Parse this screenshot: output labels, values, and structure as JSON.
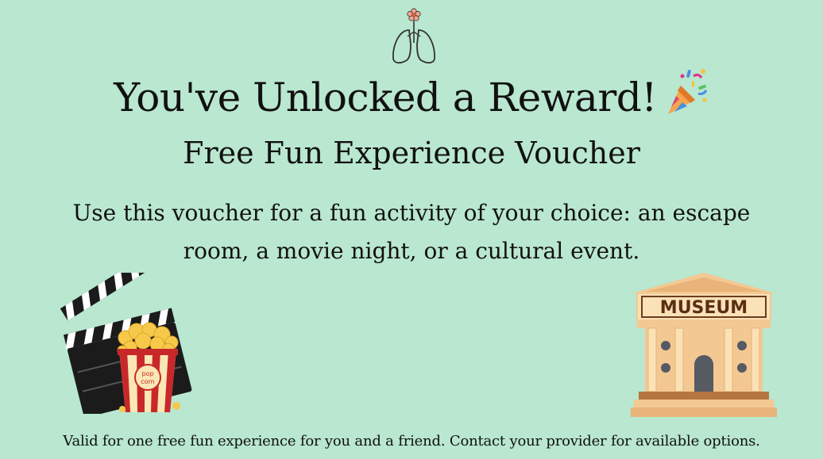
{
  "header": {
    "logo_icon": "lungs-flower-icon",
    "title": "You've Unlocked a Reward!",
    "title_icon": "party-popper-icon",
    "subtitle": "Free Fun Experience Voucher"
  },
  "main": {
    "description": "Use this voucher for a fun activity of your choice: an escape room, a movie night, or a cultural event.",
    "illustrations": {
      "left": "clapperboard-popcorn-icon",
      "right": "museum-building-icon",
      "popcorn_label_line1": "pop",
      "popcorn_label_line2": "corn",
      "museum_sign": "MUSEUM"
    }
  },
  "footer": {
    "note": "Valid for one free fun experience for you and a friend. Contact your provider for available options."
  },
  "colors": {
    "background": "#b9e7d0",
    "text": "#111111",
    "popcorn_red": "#c8282a",
    "museum_tan": "#f3c892",
    "museum_brown": "#6b3b1e"
  }
}
